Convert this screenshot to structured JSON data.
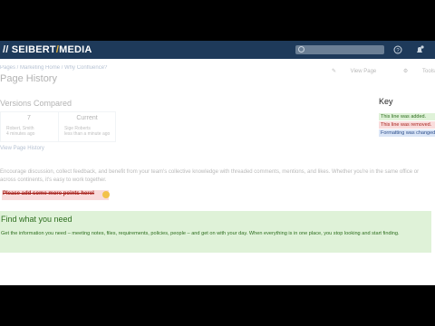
{
  "header": {
    "logo_left": "// SEIBERT",
    "logo_slash": "/",
    "logo_right": "MEDIA"
  },
  "breadcrumb": "Pages / Marketing Home / Why Confluence?",
  "page_title": "Page History",
  "actions": {
    "view_page": "View Page",
    "more": "Tools"
  },
  "versions": {
    "heading": "Versions Compared",
    "col1": {
      "num": "7",
      "author": "Robert, Smith",
      "time": "4 minutes ago"
    },
    "col2": {
      "num": "Current",
      "author": "Sige Roberts",
      "time": "less than a minute ago"
    },
    "view_history": "View Page History"
  },
  "body_text": "Encourage discussion, collect feedback, and benefit from your team's collective knowledge with threaded comments, mentions, and likes. Whether you're in the same office or across continents, it's easy to work together.",
  "key": {
    "title": "Key",
    "added": "This line was added.",
    "removed": "This line was removed.",
    "changed": "Formatting was changed."
  },
  "comment": "Please add some more points here!",
  "added_section": {
    "heading": "Find what you need",
    "text": "Get the information you need – meeting notes, files, requirements, policies, people – and get on with your day. When everything is in one place, you stop looking and start finding."
  },
  "colors": {
    "topbar": "#1e3a5a",
    "added_bg": "#dff2d8",
    "removed_bg": "#f9dcdc",
    "changed_bg": "#dbe6f7"
  },
  "icons": [
    "search-icon",
    "question-icon",
    "notifications-icon",
    "edit-icon",
    "gear-icon",
    "smiley-icon"
  ]
}
